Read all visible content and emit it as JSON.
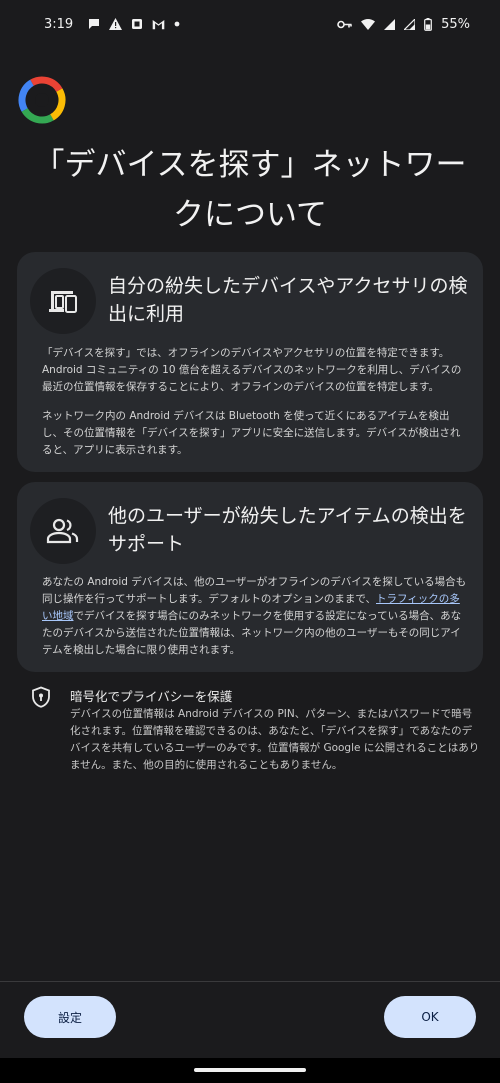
{
  "status_bar": {
    "time": "3:19",
    "battery": "55%",
    "left_icons": [
      "chat-icon",
      "warning-icon",
      "clipboard-icon",
      "gmail-icon",
      "dot-icon"
    ],
    "right_icons": [
      "key-icon",
      "wifi-icon",
      "signal-icon",
      "signal-icon",
      "battery-icon"
    ]
  },
  "header": {
    "title": "「デバイスを探す」ネットワークについて"
  },
  "cards": [
    {
      "icon": "devices-icon",
      "title": "自分の紛失したデバイスやアクセサリの検出に利用",
      "paragraphs": [
        "「デバイスを探す」では、オフラインのデバイスやアクセサリの位置を特定できます。Android コミュニティの 10 億台を超えるデバイスのネットワークを利用し、デバイスの最近の位置情報を保存することにより、オフラインのデバイスの位置を特定します。",
        "ネットワーク内の Android デバイスは Bluetooth を使って近くにあるアイテムを検出し、その位置情報を「デバイスを探す」アプリに安全に送信します。デバイスが検出されると、アプリに表示されます。"
      ]
    },
    {
      "icon": "people-icon",
      "title": "他のユーザーが紛失したアイテムの検出をサポート",
      "body_before_link": "あなたの Android デバイスは、他のユーザーがオフラインのデバイスを探している場合も同じ操作を行ってサポートします。デフォルトのオプションのままで、",
      "link": "トラフィックの多い地域",
      "body_after_link": "でデバイスを探す場合にのみネットワークを使用する設定になっている場合、あなたのデバイスから送信された位置情報は、ネットワーク内の他のユーザーもその同じアイテムを検出した場合に限り使用されます。"
    }
  ],
  "privacy": {
    "icon": "shield-icon",
    "title": "暗号化でプライバシーを保護",
    "body": "デバイスの位置情報は Android デバイスの PIN、パターン、またはパスワードで暗号化されます。位置情報を確認できるのは、あなたと、「デバイスを探す」であなたのデバイスを共有しているユーザーのみです。位置情報が Google に公開されることはありません。また、他の目的に使用されることもありません。"
  },
  "buttons": {
    "settings": "設定",
    "ok": "OK"
  },
  "colors": {
    "background": "#1b1b1d",
    "card": "#282a2e",
    "button": "#d3e3fd",
    "link": "#a8c7fa"
  }
}
